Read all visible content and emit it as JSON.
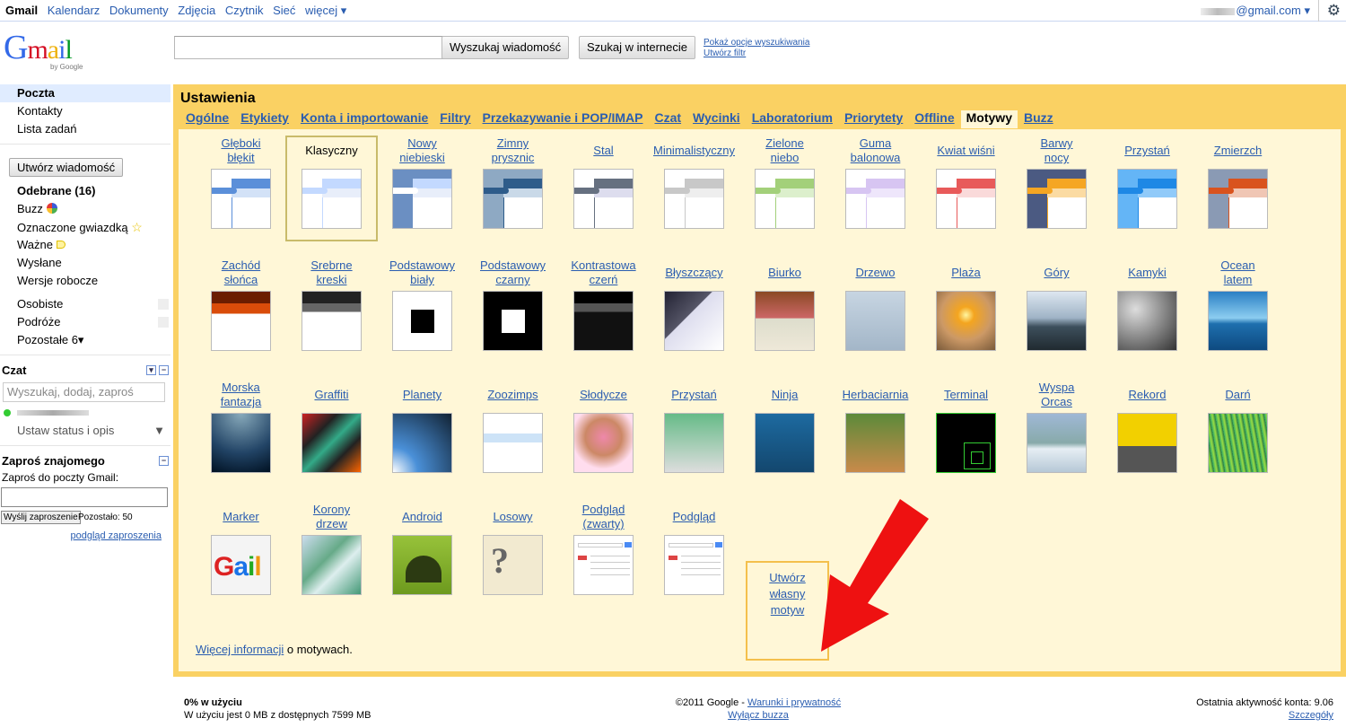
{
  "topbar": {
    "nav": [
      "Gmail",
      "Kalendarz",
      "Dokumenty",
      "Zdjęcia",
      "Czytnik",
      "Sieć",
      "więcej ▾"
    ],
    "account": "@gmail.com ▾"
  },
  "logo": {
    "text": "Gmail",
    "by": "by Google"
  },
  "search": {
    "mail_button": "Wyszukaj wiadomość",
    "web_button": "Szukaj w internecie",
    "show_options": "Pokaż opcje wyszukiwania",
    "create_filter": "Utwórz filtr"
  },
  "sidebar": {
    "top_items": [
      "Poczta",
      "Kontakty",
      "Lista zadań"
    ],
    "compose": "Utwórz wiadomość",
    "labels": [
      "Odebrane (16)",
      "Buzz",
      "Oznaczone gwiazdką",
      "Ważne",
      "Wysłane",
      "Wersje robocze"
    ],
    "user_labels": [
      "Osobiste",
      "Podróże",
      "Pozostałe 6▾"
    ],
    "chat": {
      "title": "Czat",
      "search_placeholder": "Wyszukaj, dodaj, zaproś",
      "status": "Ustaw status i opis"
    },
    "invite": {
      "title": "Zaproś znajomego",
      "label": "Zaproś do poczty Gmail:",
      "button": "Wyślij zaproszenie",
      "remaining": "Pozostało: 50",
      "preview": "podgląd zaproszenia"
    }
  },
  "settings": {
    "title": "Ustawienia",
    "tabs": [
      "Ogólne",
      "Etykiety",
      "Konta i importowanie",
      "Filtry",
      "Przekazywanie i POP/IMAP",
      "Czat",
      "Wycinki",
      "Laboratorium",
      "Priorytety",
      "Offline",
      "Motywy",
      "Buzz"
    ],
    "active_tab": "Motywy",
    "themes_row1": [
      {
        "name": "Głęboki\nbłękit",
        "c1": "#5b8fd9",
        "c2": "#d3e2f7",
        "side": "#5b8fd9"
      },
      {
        "name": "Klasyczny",
        "c1": "#c3d9ff",
        "c2": "#e8eefa",
        "side": "#c3d9ff",
        "selected": true
      },
      {
        "name": "Nowy\nniebieski",
        "c1": "#c3d9ff",
        "c2": "#e8eefa",
        "side": "#fff",
        "bg": "#6b8fc2"
      },
      {
        "name": "Zimny\nprysznic",
        "c1": "#2e5c8a",
        "c2": "#c9d9e8",
        "side": "#2e5c8a",
        "bg": "#8ea9c3"
      },
      {
        "name": "Stal",
        "c1": "#667080",
        "c2": "#dde",
        "side": "#667080"
      },
      {
        "name": "Minimalistyczny",
        "c1": "#c8c8c8",
        "c2": "#eee",
        "side": "#c8c8c8"
      },
      {
        "name": "Zielone\nniebo",
        "c1": "#a3d07a",
        "c2": "#dcefcc",
        "side": "#a3d07a"
      },
      {
        "name": "Guma\nbalonowa",
        "c1": "#d7c5f2",
        "c2": "#eee6fb",
        "side": "#d7c5f2"
      },
      {
        "name": "Kwiat wiśni",
        "c1": "#e85a5a",
        "c2": "#fadada",
        "side": "#e85a5a"
      },
      {
        "name": "Barwy\nnocy",
        "c1": "#f5a623",
        "c2": "#fbdba2",
        "side": "#f5a623",
        "bg": "#4b5a82"
      },
      {
        "name": "Przystań",
        "c1": "#1e88e5",
        "c2": "#90caf9",
        "side": "#1e88e5",
        "bg": "#64b5f6"
      },
      {
        "name": "Zmierzch",
        "c1": "#d9531e",
        "c2": "#f0c6b4",
        "side": "#d9531e",
        "bg": "#8a9ab4"
      }
    ],
    "themes_row2": [
      "Zachód\nsłońca",
      "Srebrne\nkreski",
      "Podstawowy\nbiały",
      "Podstawowy\nczarny",
      "Kontrastowa\nczerń",
      "Błyszczący",
      "Biurko",
      "Drzewo",
      "Plaża",
      "Góry",
      "Kamyki",
      "Ocean\nlatem"
    ],
    "themes_row3": [
      "Morska\nfantazja",
      "Graffiti",
      "Planety",
      "Zoozimps",
      "Słodycze",
      "Przystań",
      "Ninja",
      "Herbaciarnia",
      "Terminal",
      "Wyspa\nOrcas",
      "Rekord",
      "Darń"
    ],
    "themes_row4": [
      "Marker",
      "Korony\ndrzew",
      "Android",
      "Losowy",
      "Podgląd\n(zwarty)",
      "Podgląd"
    ],
    "create_own": "Utwórz\nwłasny\nmotyw",
    "more_info_link": "Więcej informacji",
    "more_info_rest": " o motywach."
  },
  "footer": {
    "usage_title": "0% w użyciu",
    "usage_text": "W użyciu jest 0 MB z dostępnych 7599 MB",
    "copyright": "©2011 Google - ",
    "terms": "Warunki i prywatność",
    "disable_buzz": "Wyłącz buzza",
    "last_activity": "Ostatnia aktywność konta: 9.06",
    "details": "Szczegóły"
  }
}
